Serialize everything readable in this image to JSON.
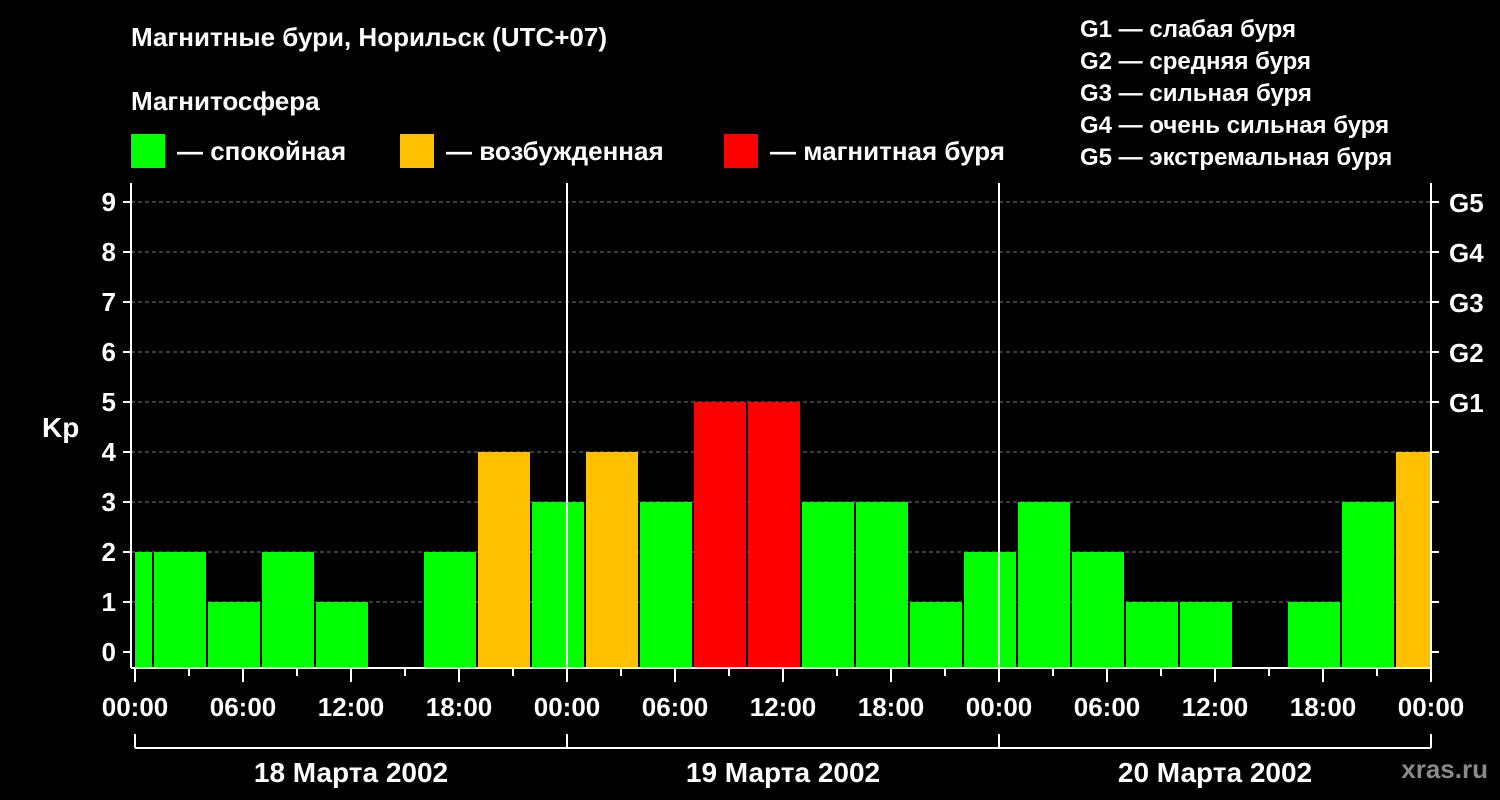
{
  "title": "Магнитные бури, Норильск (UTC+07)",
  "subtitle": "Магнитосфера",
  "legend": [
    {
      "label": "— спокойная",
      "color": "#00ff00"
    },
    {
      "label": "— возбужденная",
      "color": "#ffc000"
    },
    {
      "label": "— магнитная буря",
      "color": "#ff0000"
    }
  ],
  "g_legend": [
    "G1 — слабая буря",
    "G2 — средняя буря",
    "G3 — сильная буря",
    "G4 — очень сильная буря",
    "G5 — экстремальная буря"
  ],
  "watermark": "xras.ru",
  "chart_data": {
    "type": "bar",
    "ylabel": "Kp",
    "ylim": [
      0,
      9
    ],
    "y_ticks": [
      "0",
      "1",
      "2",
      "3",
      "4",
      "5",
      "6",
      "7",
      "8",
      "9"
    ],
    "g_ticks": [
      {
        "kp": 5,
        "label": "G1"
      },
      {
        "kp": 6,
        "label": "G2"
      },
      {
        "kp": 7,
        "label": "G3"
      },
      {
        "kp": 8,
        "label": "G4"
      },
      {
        "kp": 9,
        "label": "G5"
      }
    ],
    "x_tick_labels": [
      "00:00",
      "06:00",
      "12:00",
      "18:00",
      "00:00",
      "06:00",
      "12:00",
      "18:00",
      "00:00",
      "06:00",
      "12:00",
      "18:00",
      "00:00"
    ],
    "days": [
      "18 Марта 2002",
      "19 Марта 2002",
      "20 Марта 2002"
    ],
    "colors": {
      "quiet": "#00ff00",
      "active": "#ffc000",
      "storm": "#ff0000"
    },
    "bars": [
      {
        "start_hour": 0,
        "end_hour": 1,
        "kp": 2,
        "level": "quiet"
      },
      {
        "start_hour": 1,
        "end_hour": 4,
        "kp": 2,
        "level": "quiet"
      },
      {
        "start_hour": 4,
        "end_hour": 7,
        "kp": 1,
        "level": "quiet"
      },
      {
        "start_hour": 7,
        "end_hour": 10,
        "kp": 2,
        "level": "quiet"
      },
      {
        "start_hour": 10,
        "end_hour": 13,
        "kp": 1,
        "level": "quiet"
      },
      {
        "start_hour": 16,
        "end_hour": 19,
        "kp": 2,
        "level": "quiet"
      },
      {
        "start_hour": 19,
        "end_hour": 22,
        "kp": 4,
        "level": "active"
      },
      {
        "start_hour": 22,
        "end_hour": 25,
        "kp": 3,
        "level": "quiet"
      },
      {
        "start_hour": 25,
        "end_hour": 28,
        "kp": 4,
        "level": "active"
      },
      {
        "start_hour": 28,
        "end_hour": 31,
        "kp": 3,
        "level": "quiet"
      },
      {
        "start_hour": 31,
        "end_hour": 34,
        "kp": 5,
        "level": "storm"
      },
      {
        "start_hour": 34,
        "end_hour": 37,
        "kp": 5,
        "level": "storm"
      },
      {
        "start_hour": 37,
        "end_hour": 40,
        "kp": 3,
        "level": "quiet"
      },
      {
        "start_hour": 40,
        "end_hour": 43,
        "kp": 3,
        "level": "quiet"
      },
      {
        "start_hour": 43,
        "end_hour": 46,
        "kp": 1,
        "level": "quiet"
      },
      {
        "start_hour": 46,
        "end_hour": 49,
        "kp": 2,
        "level": "quiet"
      },
      {
        "start_hour": 49,
        "end_hour": 52,
        "kp": 3,
        "level": "quiet"
      },
      {
        "start_hour": 52,
        "end_hour": 55,
        "kp": 2,
        "level": "quiet"
      },
      {
        "start_hour": 55,
        "end_hour": 58,
        "kp": 1,
        "level": "quiet"
      },
      {
        "start_hour": 58,
        "end_hour": 61,
        "kp": 1,
        "level": "quiet"
      },
      {
        "start_hour": 64,
        "end_hour": 67,
        "kp": 1,
        "level": "quiet"
      },
      {
        "start_hour": 67,
        "end_hour": 70,
        "kp": 3,
        "level": "quiet"
      },
      {
        "start_hour": 70,
        "end_hour": 72,
        "kp": 4,
        "level": "active"
      }
    ]
  }
}
